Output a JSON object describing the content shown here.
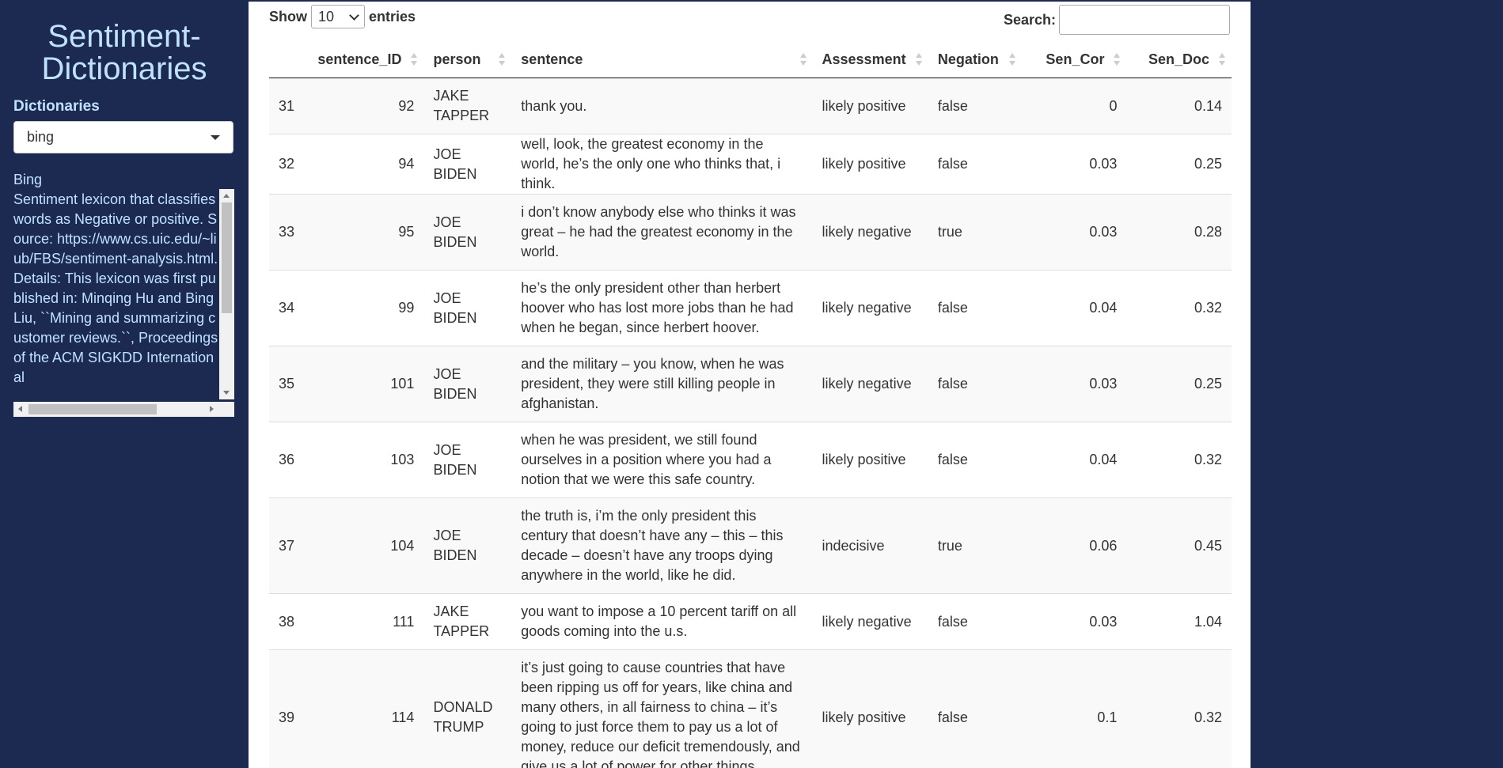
{
  "sidebar": {
    "title": "Sentiment-Dictionaries",
    "dictionaries_label": "Dictionaries",
    "selected_dictionary": "bing",
    "description": "Bing\nSentiment lexicon that classifies words as Negative or positive. Source: https://www.cs.uic.edu/~liub/FBS/sentiment-analysis.html. Details: This lexicon was first published in: Minqing Hu and Bing Liu, ``Mining and summarizing customer reviews.``, Proceedings of the ACM SIGKDD International"
  },
  "table_controls": {
    "show_label": "Show",
    "entries_value": "10",
    "entries_label": "entries",
    "search_label": "Search:",
    "search_value": ""
  },
  "columns": [
    "",
    "sentence_ID",
    "person",
    "sentence",
    "Assessment",
    "Negation",
    "Sen_Cor",
    "Sen_Doc"
  ],
  "rows": [
    {
      "idx": "31",
      "sentence_id": "92",
      "person": "JAKE TAPPER",
      "sentence": "thank you.",
      "assessment": "likely positive",
      "negation": "false",
      "sen_cor": "0",
      "sen_doc": "0.14"
    },
    {
      "idx": "32",
      "sentence_id": "94",
      "person": "JOE BIDEN",
      "sentence": "well, look, the greatest economy in the world, he’s the only one who thinks that, i think.",
      "assessment": "likely positive",
      "negation": "false",
      "sen_cor": "0.03",
      "sen_doc": "0.25"
    },
    {
      "idx": "33",
      "sentence_id": "95",
      "person": "JOE BIDEN",
      "sentence": "i don’t know anybody else who thinks it was great – he had the greatest economy in the world.",
      "assessment": "likely negative",
      "negation": "true",
      "sen_cor": "0.03",
      "sen_doc": "0.28"
    },
    {
      "idx": "34",
      "sentence_id": "99",
      "person": "JOE BIDEN",
      "sentence": "he’s the only president other than herbert hoover who has lost more jobs than he had when he began, since herbert hoover.",
      "assessment": "likely negative",
      "negation": "false",
      "sen_cor": "0.04",
      "sen_doc": "0.32"
    },
    {
      "idx": "35",
      "sentence_id": "101",
      "person": "JOE BIDEN",
      "sentence": "and the military – you know, when he was president, they were still killing people in afghanistan.",
      "assessment": "likely negative",
      "negation": "false",
      "sen_cor": "0.03",
      "sen_doc": "0.25"
    },
    {
      "idx": "36",
      "sentence_id": "103",
      "person": "JOE BIDEN",
      "sentence": "when he was president, we still found ourselves in a position where you had a notion that we were this safe country.",
      "assessment": "likely positive",
      "negation": "false",
      "sen_cor": "0.04",
      "sen_doc": "0.32"
    },
    {
      "idx": "37",
      "sentence_id": "104",
      "person": "JOE BIDEN",
      "sentence": "the truth is, i’m the only president this century that doesn’t have any – this – this decade – doesn’t have any troops dying anywhere in the world, like he did.",
      "assessment": "indecisive",
      "negation": "true",
      "sen_cor": "0.06",
      "sen_doc": "0.45"
    },
    {
      "idx": "38",
      "sentence_id": "111",
      "person": "JAKE TAPPER",
      "sentence": "you want to impose a 10 percent tariff on all goods coming into the u.s.",
      "assessment": "likely negative",
      "negation": "false",
      "sen_cor": "0.03",
      "sen_doc": "1.04"
    },
    {
      "idx": "39",
      "sentence_id": "114",
      "person": "DONALD TRUMP",
      "sentence": "it’s just going to cause countries that have been ripping us off for years, like china and many others, in all fairness to china – it’s going to just force them to pay us a lot of money, reduce our deficit tremendously, and give us a lot of power for other things.",
      "assessment": "likely positive",
      "negation": "false",
      "sen_cor": "0.1",
      "sen_doc": "0.32"
    }
  ]
}
